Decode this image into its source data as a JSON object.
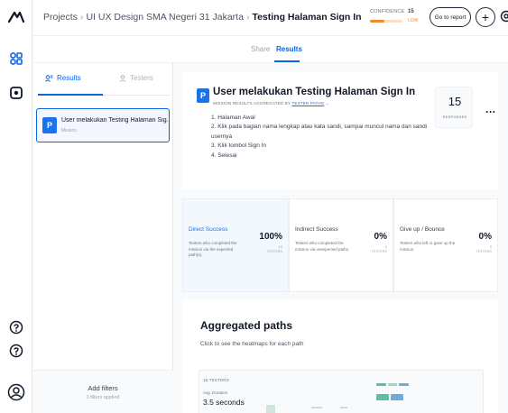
{
  "breadcrumb": {
    "root": "Projects",
    "project": "UI UX Design SMA Negeri 31 Jakarta",
    "current": "Testing Halaman Sign In"
  },
  "topbar": {
    "confidence_label": "CONFIDENCE",
    "confidence_value": "15",
    "confidence_sub": "LOW",
    "confidence_level": 0.45,
    "go_to_report_label": "Go to report",
    "add_label": "+"
  },
  "view_tabs": {
    "share_label": "Share",
    "results_label": "Results"
  },
  "left_panel": {
    "tab_results": "Results",
    "tab_testers": "Testers",
    "mission": {
      "badge": "P",
      "title": "User melakukan Testing Halaman Sig...",
      "subtitle": "Mission"
    },
    "add_filters": "Add filters",
    "filters_applied": "0 filters applied"
  },
  "mission": {
    "badge": "P",
    "title": "User melakukan Testing Halaman Sign In",
    "meta_prefix": "MISSION RESULTS AGGREGATED BY",
    "meta_link": "TESTER PATHS",
    "steps": [
      "1. Halaman Awal",
      "2. Klik pada bagian nama lengkap atau kata sandi, sampai muncul nama dan sandi",
      "usernya",
      "3. Klik tombol Sign In",
      "4. Selesai"
    ],
    "responses_count": "15",
    "responses_label": "RESPONSES",
    "more_label": "..."
  },
  "stats": {
    "direct": {
      "name": "Direct Success",
      "desc": "Testers who completed the mission via the expected path(s).",
      "pct": "100%",
      "count": "15",
      "testers_label": "TESTERS"
    },
    "indirect": {
      "name": "Indirect Success",
      "desc": "Testers who completed the mission via unexpected paths.",
      "pct": "0%",
      "count": "0",
      "testers_label": "TESTERS"
    },
    "giveup": {
      "name": "Give up / Bounce",
      "desc": "Testers who left or gave up the mission.",
      "pct": "0%",
      "count": "0",
      "testers_label": "TESTERS"
    }
  },
  "aggregated": {
    "heading": "Aggregated paths",
    "prompt": "Click to see the heatmaps for each path",
    "path": {
      "testers_count": "15 TESTERS",
      "avg_label": "Avg. Duration",
      "duration": "3.5 seconds"
    }
  },
  "colors": {
    "accent": "#0b66e4",
    "confidence": "#f08c2e"
  },
  "rail_icons": [
    "logo-icon",
    "grid-icon",
    "test-icon",
    "help-icon",
    "info-icon",
    "user-icon"
  ]
}
